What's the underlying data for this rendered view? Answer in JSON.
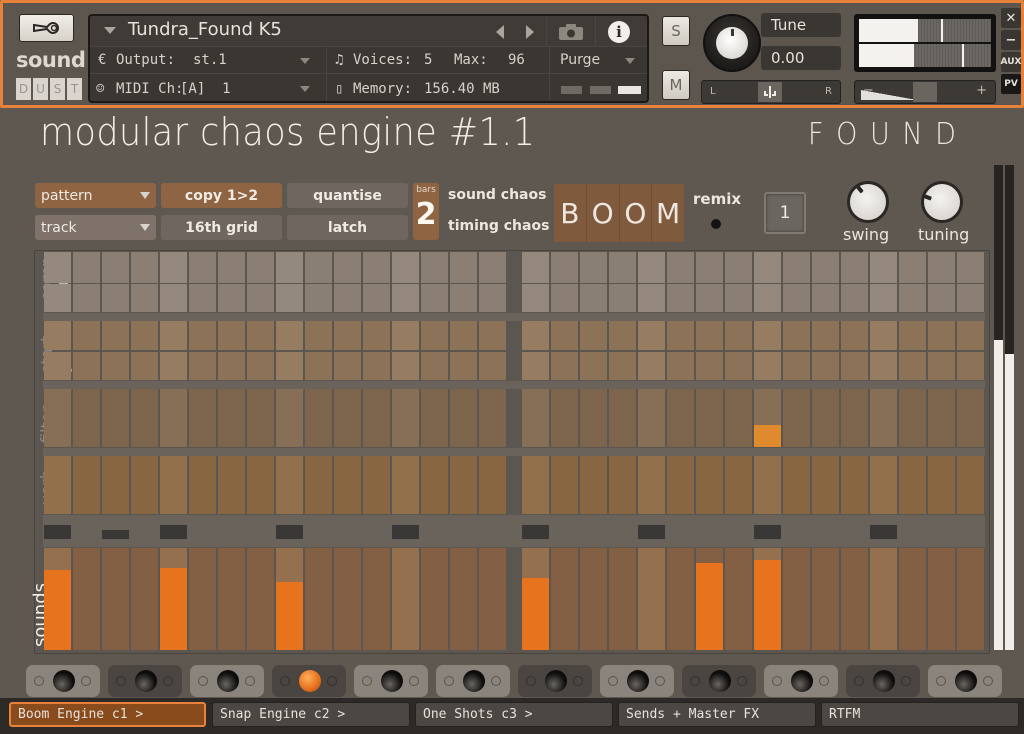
{
  "header": {
    "logo": {
      "word": "sound",
      "letters": [
        "D",
        "U",
        "S",
        "T"
      ]
    },
    "instrument_name": "Tundra_Found K5",
    "output_label": "Output:",
    "output_value": "st.1",
    "midi_label": "MIDI Ch:",
    "midi_value": "[A]  1",
    "voices_label": "Voices:",
    "voices_value": "5",
    "max_label": "Max:",
    "max_value": "96",
    "memory_label": "Memory:",
    "memory_value": "156.40 MB",
    "purge_label": "Purge",
    "solo_label": "S",
    "mute_label": "M",
    "tune_label": "Tune",
    "tune_value": "0.00",
    "pan_left": "L",
    "pan_right": "R",
    "vol_minus": "−",
    "vol_plus": "+",
    "side_buttons": [
      "✕",
      "−",
      "AUX",
      "PV"
    ],
    "output_meter": {
      "left_level": 0.45,
      "left_peak": 0.62,
      "right_level": 0.42,
      "right_peak": 0.78
    }
  },
  "main": {
    "title": "modular chaos engine #1.1",
    "brand": "FOUND",
    "pattern_dropdown": "pattern",
    "track_dropdown": "track",
    "copy_button": "copy 1>2",
    "grid_button": "16th grid",
    "quantise_button": "quantise",
    "latch_button": "latch",
    "bars_label": "bars",
    "bars_value": "2",
    "sound_chaos_label": "sound chaos",
    "timing_chaos_label": "timing chaos",
    "boom_letters": [
      "B",
      "O",
      "O",
      "M"
    ],
    "remix_label": "remix",
    "pattern_number": "1",
    "swing_label": "swing",
    "tuning_label": "tuning",
    "colors": {
      "accent": "#e8731f",
      "active_tab": "#8a4b1c",
      "frame": "#e8823a"
    }
  },
  "sequencer": {
    "steps": 32,
    "lanes": [
      {
        "top_label": "comp",
        "bottom_label": "tune"
      },
      {
        "top_label": "start",
        "bottom_label": "pan"
      },
      {
        "top_label": "filter",
        "bottom_label": "hold"
      },
      {
        "top_label": "verb",
        "bottom_label": "vol"
      }
    ],
    "sounds_label": "sounds",
    "hold_active_steps": [
      24
    ],
    "step_indicators": [
      0,
      4,
      8,
      12,
      16,
      20,
      24,
      28
    ],
    "playhead_step": 2,
    "sound_hits": [
      {
        "step": 0,
        "level": 0.78
      },
      {
        "step": 4,
        "level": 0.8
      },
      {
        "step": 8,
        "level": 0.67
      },
      {
        "step": 16,
        "level": 0.71
      },
      {
        "step": 22,
        "level": 0.85
      },
      {
        "step": 24,
        "level": 0.88
      }
    ],
    "master_meter": {
      "left": 0.64,
      "right": 0.61
    }
  },
  "mixer": {
    "channels": 12,
    "active_channel": 3,
    "dark_channels": [
      1,
      3,
      6,
      8,
      10
    ]
  },
  "tabs": [
    {
      "label": "Boom Engine c1 >",
      "active": true
    },
    {
      "label": "Snap Engine c2 >",
      "active": false
    },
    {
      "label": "One Shots c3 >",
      "active": false
    },
    {
      "label": "Sends + Master FX",
      "active": false
    },
    {
      "label": "RTFM",
      "active": false
    }
  ]
}
